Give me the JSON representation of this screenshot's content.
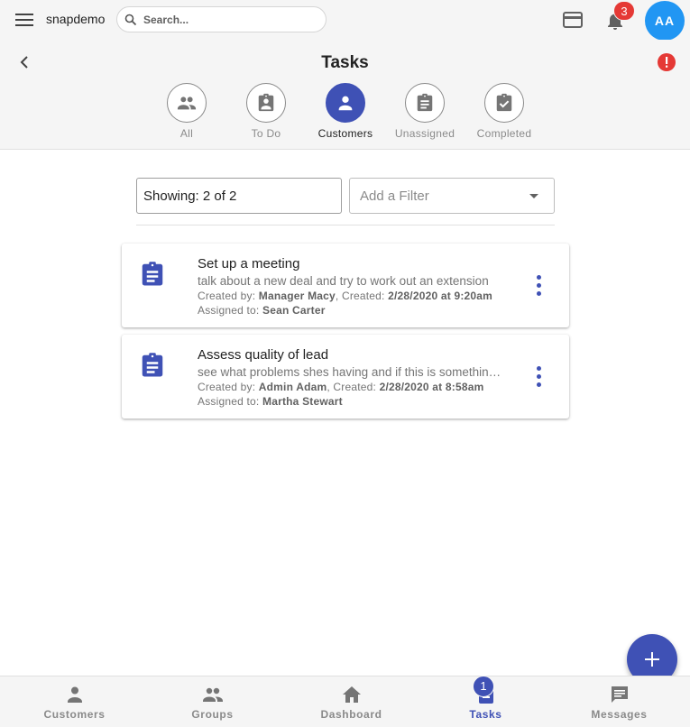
{
  "topbar": {
    "brand": "snapdemo",
    "search_placeholder": "Search...",
    "notifications_count": "3",
    "avatar_initials": "AA"
  },
  "header": {
    "title": "Tasks",
    "filter_tabs": [
      {
        "label": "All",
        "icon": "group-icon",
        "active": false
      },
      {
        "label": "To Do",
        "icon": "assignment-ind-icon",
        "active": false
      },
      {
        "label": "Customers",
        "icon": "person-icon",
        "active": true
      },
      {
        "label": "Unassigned",
        "icon": "assignment-icon",
        "active": false
      },
      {
        "label": "Completed",
        "icon": "assignment-done-icon",
        "active": false
      }
    ]
  },
  "filters": {
    "showing": "Showing: 2 of 2",
    "add_filter_placeholder": "Add a Filter"
  },
  "tasks": [
    {
      "title": "Set up a meeting",
      "description": "talk about a new deal and try to work out an extension",
      "created_by_label": "Created by:",
      "created_by": "Manager Macy",
      "created_label": ", Created:",
      "created": "2/28/2020 at 9:20am",
      "assigned_label": "Assigned to:",
      "assigned_to": "Sean Carter"
    },
    {
      "title": "Assess quality of lead",
      "description": "see what problems shes having and if this is something we can fix",
      "created_by_label": "Created by:",
      "created_by": "Admin Adam",
      "created_label": ", Created:",
      "created": "2/28/2020 at 8:58am",
      "assigned_label": "Assigned to:",
      "assigned_to": "Martha Stewart"
    }
  ],
  "bottom_nav": {
    "items": [
      {
        "label": "Customers",
        "icon": "person-icon",
        "active": false
      },
      {
        "label": "Groups",
        "icon": "group-icon",
        "active": false
      },
      {
        "label": "Dashboard",
        "icon": "home-icon",
        "active": false
      },
      {
        "label": "Tasks",
        "icon": "assignment-icon",
        "active": true
      },
      {
        "label": "Messages",
        "icon": "message-icon",
        "active": false
      }
    ],
    "tasks_badge": "1"
  },
  "colors": {
    "accent": "#3f51b5",
    "badge_red": "#e53935",
    "avatar_blue": "#2196f3",
    "inactive_grey": "#8a8a8a"
  }
}
